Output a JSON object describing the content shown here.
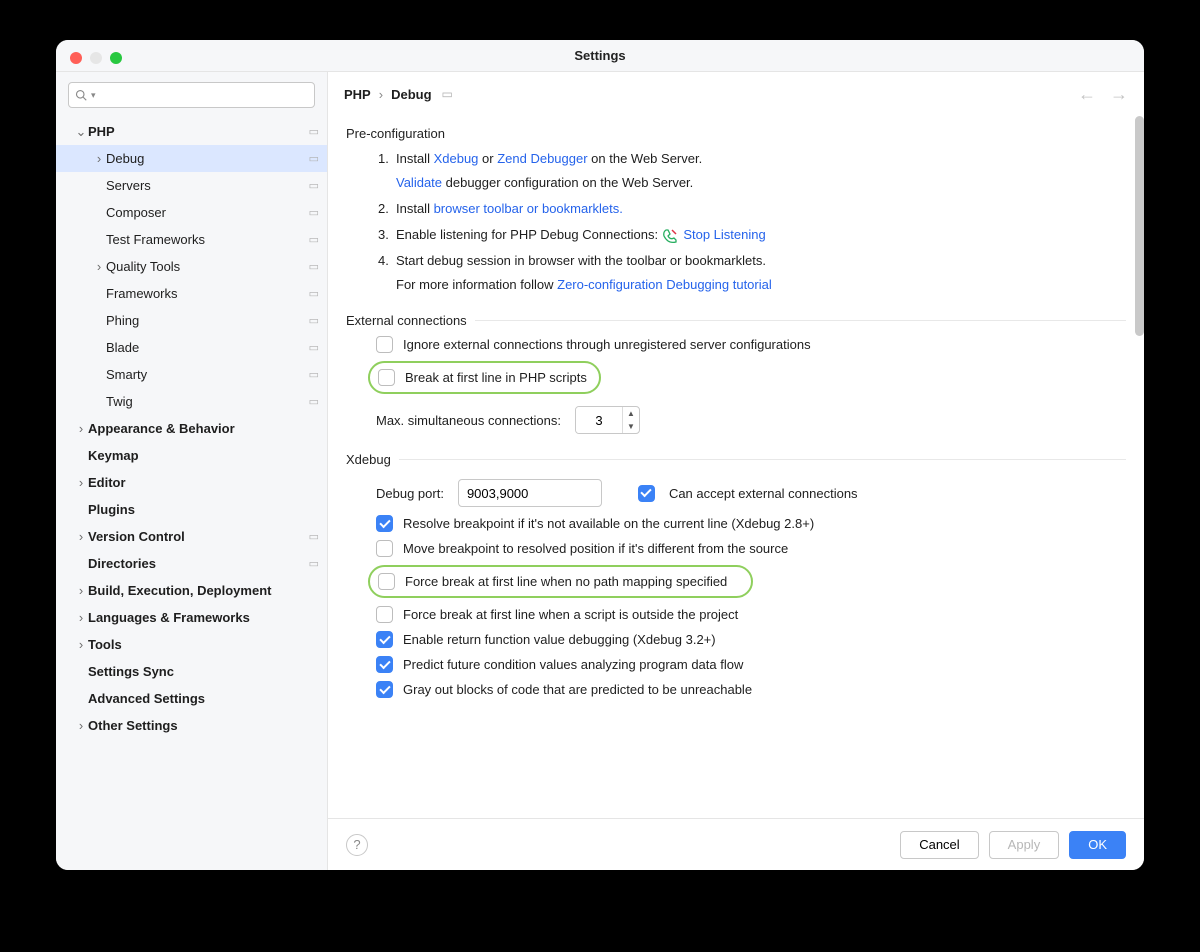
{
  "window_title": "Settings",
  "search_placeholder": "",
  "sidebar": [
    {
      "label": "PHP",
      "depth": 0,
      "arrow": "down",
      "bold": true,
      "reset": true
    },
    {
      "label": "Debug",
      "depth": 1,
      "arrow": "right",
      "sel": true,
      "reset": true
    },
    {
      "label": "Servers",
      "depth": 1,
      "reset": true
    },
    {
      "label": "Composer",
      "depth": 1,
      "reset": true
    },
    {
      "label": "Test Frameworks",
      "depth": 1,
      "reset": true
    },
    {
      "label": "Quality Tools",
      "depth": 1,
      "arrow": "right",
      "reset": true
    },
    {
      "label": "Frameworks",
      "depth": 1,
      "reset": true
    },
    {
      "label": "Phing",
      "depth": 1,
      "reset": true
    },
    {
      "label": "Blade",
      "depth": 1,
      "reset": true
    },
    {
      "label": "Smarty",
      "depth": 1,
      "reset": true
    },
    {
      "label": "Twig",
      "depth": 1,
      "reset": true
    },
    {
      "label": "Appearance & Behavior",
      "depth": 0,
      "arrow": "right",
      "bold": true
    },
    {
      "label": "Keymap",
      "depth": 0,
      "bold": true
    },
    {
      "label": "Editor",
      "depth": 0,
      "arrow": "right",
      "bold": true
    },
    {
      "label": "Plugins",
      "depth": 0,
      "bold": true
    },
    {
      "label": "Version Control",
      "depth": 0,
      "arrow": "right",
      "bold": true,
      "reset": true
    },
    {
      "label": "Directories",
      "depth": 0,
      "bold": true,
      "reset": true
    },
    {
      "label": "Build, Execution, Deployment",
      "depth": 0,
      "arrow": "right",
      "bold": true
    },
    {
      "label": "Languages & Frameworks",
      "depth": 0,
      "arrow": "right",
      "bold": true
    },
    {
      "label": "Tools",
      "depth": 0,
      "arrow": "right",
      "bold": true
    },
    {
      "label": "Settings Sync",
      "depth": 0,
      "bold": true
    },
    {
      "label": "Advanced Settings",
      "depth": 0,
      "bold": true
    },
    {
      "label": "Other Settings",
      "depth": 0,
      "arrow": "right",
      "bold": true
    }
  ],
  "crumb1": "PHP",
  "crumb2": "Debug",
  "sections": {
    "preconf_title": "Pre-configuration",
    "li1_a": "Install ",
    "li1_link1": "Xdebug",
    "li1_b": " or ",
    "li1_link2": "Zend Debugger",
    "li1_c": " on the Web Server.",
    "li1_sub_link": "Validate",
    "li1_sub": " debugger configuration on the Web Server.",
    "li2_a": "Install ",
    "li2_link": "browser toolbar or bookmarklets.",
    "li3_a": "Enable listening for PHP Debug Connections:  ",
    "li3_link": "Stop Listening",
    "li4_a": "Start debug session in browser with the toolbar or bookmarklets.",
    "li4_sub_a": "For more information follow ",
    "li4_sub_link": "Zero-configuration Debugging tutorial",
    "ext_title": "External connections",
    "ext_cb1": "Ignore external connections through unregistered server configurations",
    "ext_cb2": "Break at first line in PHP scripts",
    "ext_max_label": "Max. simultaneous connections:",
    "ext_max_value": "3",
    "xdebug_title": "Xdebug",
    "xdebug_port_label": "Debug port:",
    "xdebug_port_value": "9003,9000",
    "xdebug_accept": "Can accept external connections",
    "x_cb1": "Resolve breakpoint if it's not available on the current line (Xdebug 2.8+)",
    "x_cb2": "Move breakpoint to resolved position if it's different from the source",
    "x_cb3": "Force break at first line when no path mapping specified",
    "x_cb4": "Force break at first line when a script is outside the project",
    "x_cb5": "Enable return function value debugging (Xdebug 3.2+)",
    "x_cb6": "Predict future condition values analyzing program data flow",
    "x_cb7": "Gray out blocks of code that are predicted to be unreachable"
  },
  "buttons": {
    "cancel": "Cancel",
    "apply": "Apply",
    "ok": "OK"
  }
}
